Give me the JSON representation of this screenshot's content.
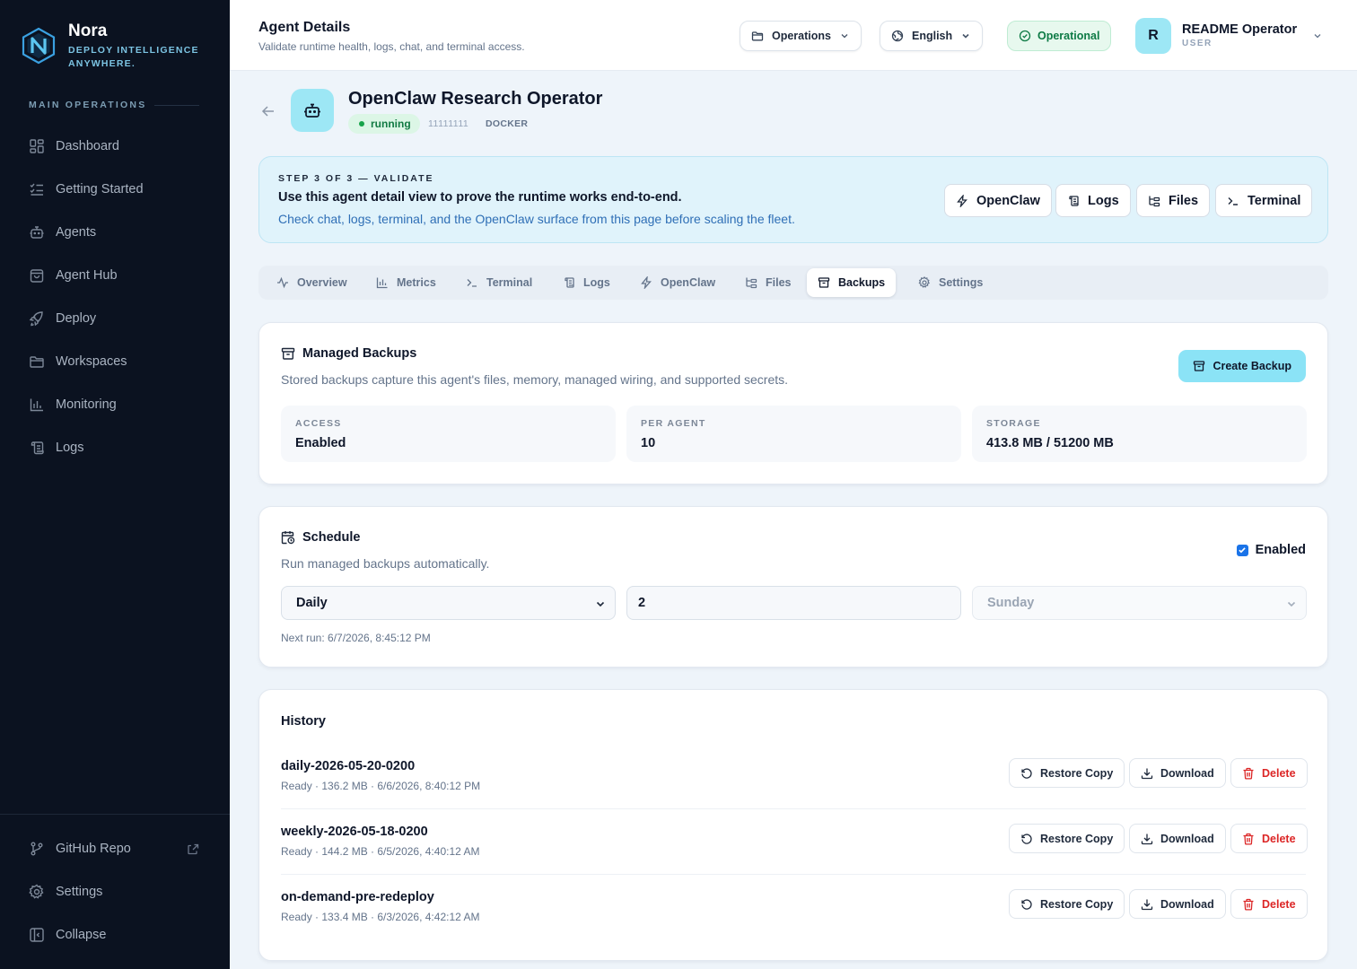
{
  "brand": {
    "name": "Nora",
    "tagline": "DEPLOY INTELLIGENCE ANYWHERE."
  },
  "sidebar": {
    "section_label": "MAIN OPERATIONS",
    "items": [
      {
        "label": "Dashboard",
        "icon": "dashboard-icon"
      },
      {
        "label": "Getting Started",
        "icon": "checklist-icon"
      },
      {
        "label": "Agents",
        "icon": "bot-icon"
      },
      {
        "label": "Agent Hub",
        "icon": "shopping-bag-icon"
      },
      {
        "label": "Deploy",
        "icon": "rocket-icon"
      },
      {
        "label": "Workspaces",
        "icon": "folder-icon"
      },
      {
        "label": "Monitoring",
        "icon": "bar-chart-icon"
      },
      {
        "label": "Logs",
        "icon": "scroll-icon"
      }
    ],
    "bottom": [
      {
        "label": "GitHub Repo",
        "icon": "git-branch-icon"
      },
      {
        "label": "Settings",
        "icon": "gear-icon"
      },
      {
        "label": "Collapse",
        "icon": "collapse-icon"
      }
    ]
  },
  "header": {
    "title": "Agent Details",
    "subtitle": "Validate runtime health, logs, chat, and terminal access.",
    "workspace": "Operations",
    "language": "English",
    "status": "Operational",
    "user_initial": "R",
    "user_name": "README Operator",
    "user_role": "USER"
  },
  "agent": {
    "name": "OpenClaw Research Operator",
    "state": "running",
    "id": "11111111",
    "runtime": "DOCKER"
  },
  "banner": {
    "step": "STEP 3 OF 3 — VALIDATE",
    "title": "Use this agent detail view to prove the runtime works end-to-end.",
    "description": "Check chat, logs, terminal, and the OpenClaw surface from this page before scaling the fleet.",
    "buttons": [
      "OpenClaw",
      "Logs",
      "Files",
      "Terminal"
    ]
  },
  "tabs": [
    "Overview",
    "Metrics",
    "Terminal",
    "Logs",
    "OpenClaw",
    "Files",
    "Backups",
    "Settings"
  ],
  "active_tab": "Backups",
  "backups": {
    "title": "Managed Backups",
    "description": "Stored backups capture this agent's files, memory, managed wiring, and supported secrets.",
    "create_label": "Create Backup",
    "stats": [
      {
        "label": "ACCESS",
        "value": "Enabled"
      },
      {
        "label": "PER AGENT",
        "value": "10"
      },
      {
        "label": "STORAGE",
        "value": "413.8 MB / 51200 MB"
      }
    ]
  },
  "schedule": {
    "title": "Schedule",
    "description": "Run managed backups automatically.",
    "enabled_label": "Enabled",
    "enabled": true,
    "frequency": "Daily",
    "hour": "2",
    "weekday": "Sunday",
    "next_run": "Next run: 6/7/2026, 8:45:12 PM"
  },
  "history": {
    "title": "History",
    "actions": {
      "restore": "Restore Copy",
      "download": "Download",
      "delete": "Delete"
    },
    "rows": [
      {
        "name": "daily-2026-05-20-0200",
        "meta": "Ready · 136.2 MB · 6/6/2026, 8:40:12 PM"
      },
      {
        "name": "weekly-2026-05-18-0200",
        "meta": "Ready · 144.2 MB · 6/5/2026, 4:40:12 AM"
      },
      {
        "name": "on-demand-pre-redeploy",
        "meta": "Ready · 133.4 MB · 6/3/2026, 4:42:12 AM"
      }
    ]
  },
  "colors": {
    "sidebar_bg": "#0b1220",
    "accent": "#8be3f6",
    "running_green": "#16a34a",
    "danger": "#dc2626",
    "link_blue": "#2f6fb6"
  }
}
